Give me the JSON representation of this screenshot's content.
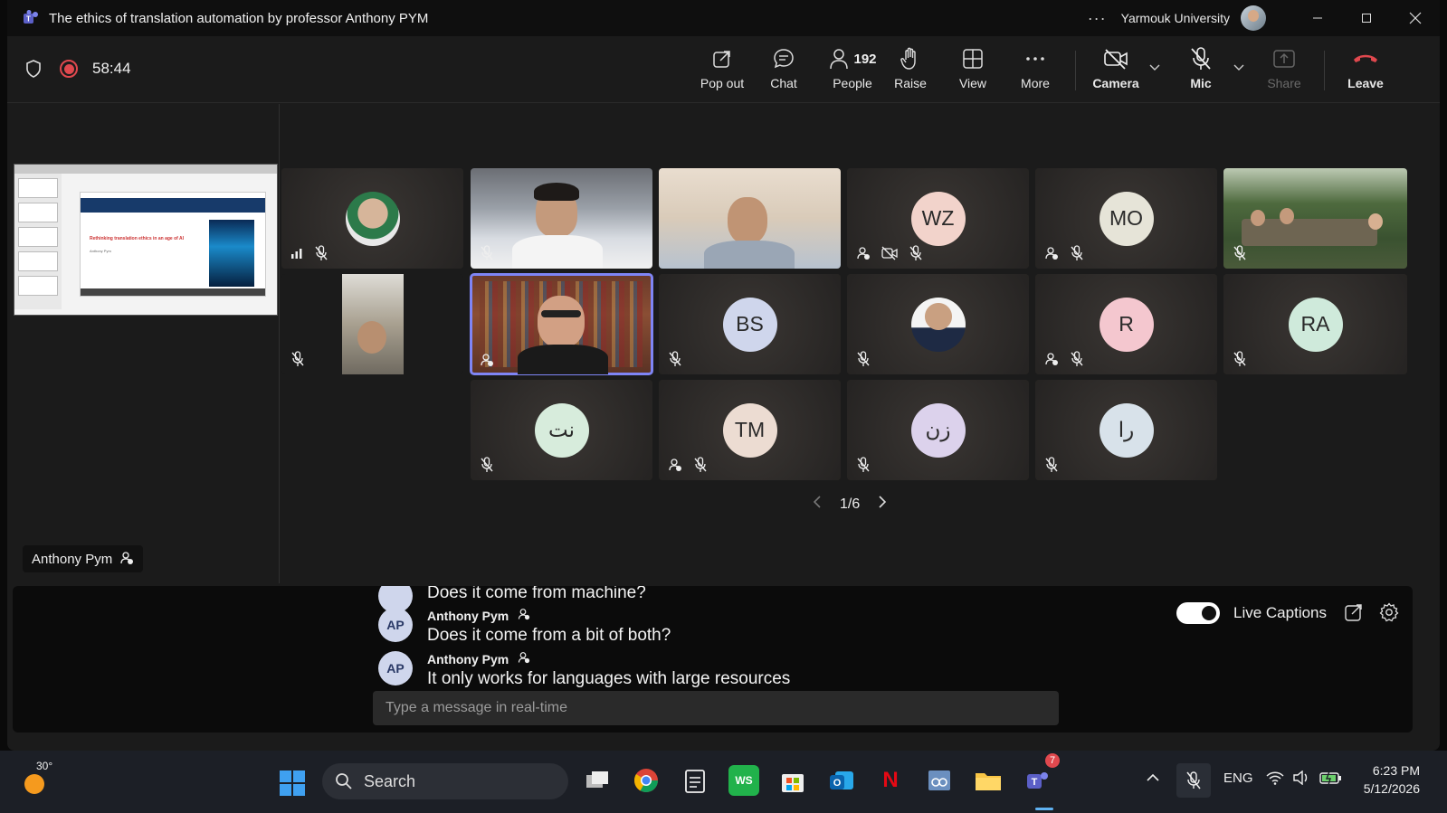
{
  "window": {
    "title": "The ethics of translation automation by professor Anthony PYM",
    "more_label": "···",
    "org": "Yarmouk University"
  },
  "meeting": {
    "timer": "58:44",
    "people_count": "192"
  },
  "toolbar": {
    "popout": "Pop out",
    "chat": "Chat",
    "people": "People",
    "raise": "Raise",
    "view": "View",
    "more": "More",
    "camera": "Camera",
    "mic": "Mic",
    "share": "Share",
    "leave": "Leave"
  },
  "stage": {
    "speaker_name": "Anthony Pym",
    "slide_title": "Rethinking translation ethics in an age of AI",
    "slide_author": "Anthony Pym"
  },
  "tiles": {
    "wz": "WZ",
    "mo": "MO",
    "bs": "BS",
    "r": "R",
    "ra": "RA",
    "nt": "نت",
    "tm": "TM",
    "zn": "زن",
    "ra2": "را"
  },
  "tile_colors": {
    "wz": "#f2d3cb",
    "mo": "#e6e4d8",
    "bs": "#cfd6ec",
    "r": "#f4c7cf",
    "ra": "#cfeadb",
    "nt": "#d7ecdc",
    "tm": "#ecdcd2",
    "zn": "#dcd2ec",
    "ra2": "#d8e2ea"
  },
  "pager": {
    "label": "1/6"
  },
  "captions": {
    "prev_text": "Does it come from machine?",
    "lines": [
      {
        "initials": "AP",
        "name": "Anthony Pym",
        "text": "Does it come from a bit of both?"
      },
      {
        "initials": "AP",
        "name": "Anthony Pym",
        "text": "It only works for languages with large resources"
      }
    ],
    "input_placeholder": "Type a message in real-time",
    "live_label": "Live Captions"
  },
  "taskbar": {
    "weather_temp": "30°",
    "search_label": "Search",
    "teams_badge": "7",
    "lang": "ENG",
    "time": "6:23 PM",
    "date": "5/12/2026"
  },
  "colors": {
    "accent": "#7f85f5",
    "record": "#e0484e",
    "leave": "#e0484e"
  }
}
